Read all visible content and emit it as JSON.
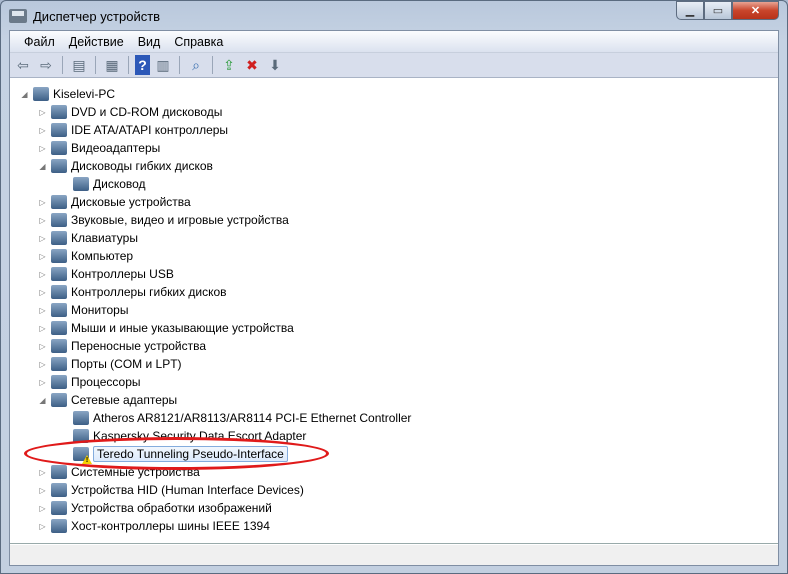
{
  "window": {
    "title": "Диспетчер устройств",
    "buttons": [
      "minimize",
      "maximize",
      "close"
    ]
  },
  "menu": [
    "Файл",
    "Действие",
    "Вид",
    "Справка"
  ],
  "toolbar": [
    "back-icon",
    "forward-icon",
    "show-hide-console-tree-icon",
    "properties-icon",
    "help-icon",
    "show-action-pane-icon",
    "scan-hardware-icon",
    "update-driver-icon",
    "disable-device-icon",
    "uninstall-device-icon"
  ],
  "tree": [
    {
      "label": "Kiselevi-PC",
      "level": 0,
      "expanded": true
    },
    {
      "label": "DVD и CD-ROM дисководы",
      "level": 1
    },
    {
      "label": "IDE ATA/ATAPI контроллеры",
      "level": 1
    },
    {
      "label": "Видеоадаптеры",
      "level": 1
    },
    {
      "label": "Дисководы гибких дисков",
      "level": 1,
      "expanded": true
    },
    {
      "label": "Дисковод",
      "level": 2
    },
    {
      "label": "Дисковые устройства",
      "level": 1
    },
    {
      "label": "Звуковые, видео и игровые устройства",
      "level": 1
    },
    {
      "label": "Клавиатуры",
      "level": 1
    },
    {
      "label": "Компьютер",
      "level": 1
    },
    {
      "label": "Контроллеры USB",
      "level": 1
    },
    {
      "label": "Контроллеры гибких дисков",
      "level": 1
    },
    {
      "label": "Мониторы",
      "level": 1
    },
    {
      "label": "Мыши и иные указывающие устройства",
      "level": 1
    },
    {
      "label": "Переносные устройства",
      "level": 1
    },
    {
      "label": "Порты (COM и LPT)",
      "level": 1
    },
    {
      "label": "Процессоры",
      "level": 1
    },
    {
      "label": "Сетевые адаптеры",
      "level": 1,
      "expanded": true
    },
    {
      "label": "Atheros AR8121/AR8113/AR8114 PCI-E Ethernet Controller",
      "level": 2
    },
    {
      "label": "Kaspersky Security Data Escort Adapter",
      "level": 2
    },
    {
      "label": "Teredo Tunneling Pseudo-Interface",
      "level": 2,
      "selected": true,
      "warning": true
    },
    {
      "label": "Системные устройства",
      "level": 1
    },
    {
      "label": "Устройства HID (Human Interface Devices)",
      "level": 1
    },
    {
      "label": "Устройства обработки изображений",
      "level": 1
    },
    {
      "label": "Хост-контроллеры шины IEEE 1394",
      "level": 1
    }
  ],
  "highlight_color": "#e01a1a"
}
